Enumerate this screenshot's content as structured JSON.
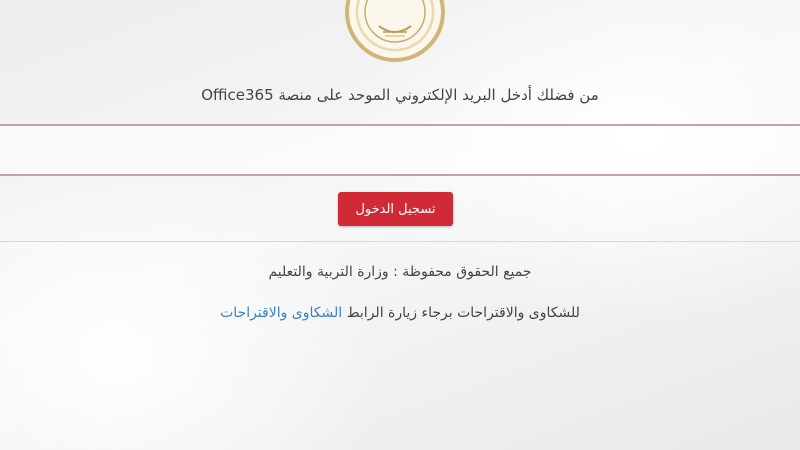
{
  "logo": {
    "icon": "ministry-seal-icon",
    "gold": "#cfb677"
  },
  "login": {
    "prompt": "من فضلك أدخل البريد الإلكتروني الموحد على منصة Office365",
    "email_value": "",
    "button_label": "تسجيل الدخول",
    "button_color": "#d12a37"
  },
  "footer": {
    "copyright": "جميع الحقوق محفوظة : وزارة التربية والتعليم",
    "complaints_text": "للشكاوى والاقتراحات برجاء زيارة الرابط",
    "complaints_link": "الشكاوى والاقتراحات",
    "link_color": "#3b7fc4"
  }
}
